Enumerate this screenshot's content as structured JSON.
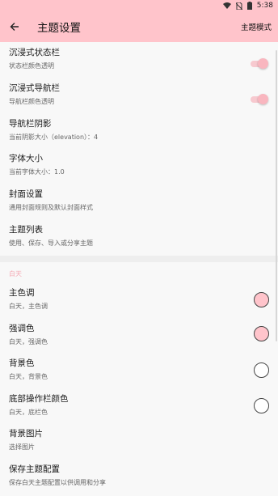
{
  "status_bar": {
    "time": "5:38",
    "icons": [
      "wifi-icon",
      "no-sim-icon",
      "battery-icon"
    ]
  },
  "app_bar": {
    "title": "主题设置",
    "action": "主题模式",
    "back_icon": "arrow-left-icon"
  },
  "settings": [
    {
      "title": "沉浸式状态栏",
      "subtitle": "状态栏颜色透明",
      "toggle": true
    },
    {
      "title": "沉浸式导航栏",
      "subtitle": "导航栏颜色透明",
      "toggle": true
    },
    {
      "title": "导航栏阴影",
      "subtitle": "当前阴影大小（elevation）：4"
    },
    {
      "title": "字体大小",
      "subtitle": "当前字体大小：1.0"
    },
    {
      "title": "封面设置",
      "subtitle": "通用封面规则及默认封面样式"
    },
    {
      "title": "主题列表",
      "subtitle": "使用、保存、导入或分享主题"
    }
  ],
  "day_section": {
    "label": "白天",
    "items": [
      {
        "title": "主色调",
        "subtitle": "白天，主色调",
        "color": "#ffc4cb"
      },
      {
        "title": "强调色",
        "subtitle": "白天，强调色",
        "color": "#ffc4cb"
      },
      {
        "title": "背景色",
        "subtitle": "白天，背景色",
        "color": "#ffffff"
      },
      {
        "title": "底部操作栏颜色",
        "subtitle": "白天，底栏色",
        "color": "#ffffff"
      },
      {
        "title": "背景图片",
        "subtitle": "选择图片"
      },
      {
        "title": "保存主题配置",
        "subtitle": "保存白天主题配置以供调用和分享"
      }
    ]
  },
  "colors": {
    "primary": "#ffc4cb",
    "toggle_track": "#f7c9cf",
    "toggle_thumb": "#f9b6bf",
    "section_label": "#f5aab5"
  }
}
